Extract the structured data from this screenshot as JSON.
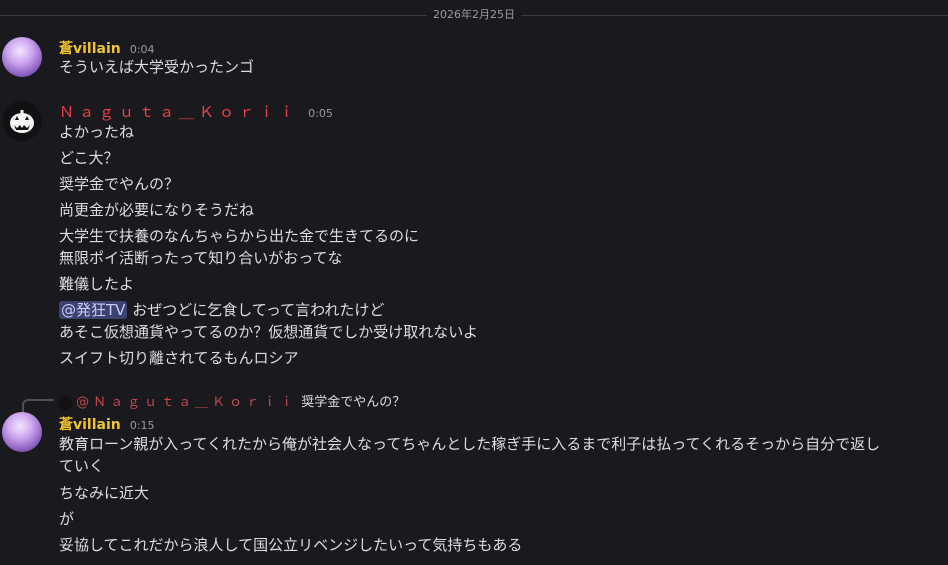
{
  "date_divider": "2026年2月25日",
  "messages": [
    {
      "author": "蒼villain",
      "time": "0:04",
      "lines": [
        "そういえば大学受かったンゴ"
      ]
    },
    {
      "author": "Ｎａｇｕｔａ＿Ｋｏｒｉｉ",
      "time": "0:05",
      "lines": [
        "よかったね",
        "どこ大？",
        "奨学金でやんの？",
        "尚更金が必要になりそうだね",
        "大学生で扶養のなんちゃらから出た金で生きてるのに",
        "無限ポイ活断ったって知り合いがおってな",
        "難儀したよ",
        "おぜつどに乞食してって言われたけど",
        "あそこ仮想通貨やってるのか？仮想通貨でしか受け取れないよ",
        "スイフト切り離されてるもんロシア"
      ],
      "mention": "@発狂TV"
    },
    {
      "reply_to_author": "@Ｎａｇｕｔａ＿Ｋｏｒｉｉ",
      "reply_to_text": "奨学金でやんの？",
      "author": "蒼villain",
      "time": "0:15",
      "lines": [
        "教育ローン親が入ってくれたから俺が社会人なってちゃんとした稼ぎ手に入るまで利子は払ってくれるそっから自分で返し",
        "ていく",
        "ちなみに近大",
        "が",
        "妥協してこれだから浪人して国公立リベンジしたいって気持ちもある"
      ]
    }
  ],
  "colors": {
    "background": "#1a1a1e",
    "villain_name": "#f0c431",
    "naguta_name": "#e8414a",
    "mention_bg": "#3c4270"
  }
}
